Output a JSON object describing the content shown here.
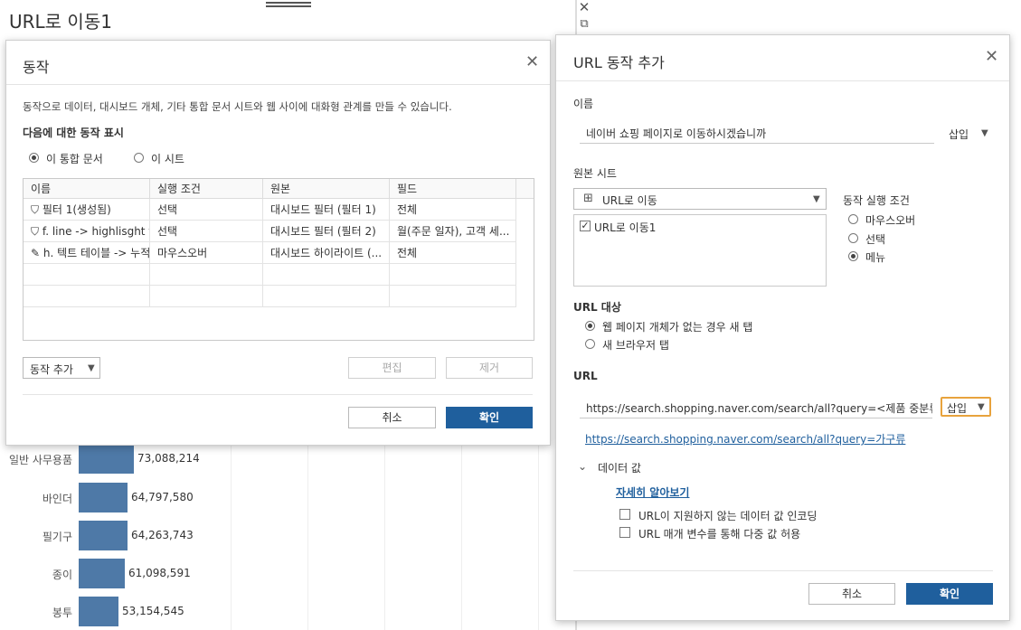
{
  "worksheet": {
    "title": "URL로 이동1",
    "bars": [
      {
        "label": "일반 사무용품",
        "value": 73088214,
        "value_text": "73,088,214"
      },
      {
        "label": "바인더",
        "value": 64797580,
        "value_text": "64,797,580"
      },
      {
        "label": "필기구",
        "value": 64263743,
        "value_text": "64,263,743"
      },
      {
        "label": "종이",
        "value": 61098591,
        "value_text": "61,098,591"
      },
      {
        "label": "봉투",
        "value": 53154545,
        "value_text": "53,154,545"
      }
    ],
    "close_glyph": "✕",
    "popout_glyph": "⧉"
  },
  "actions_dialog": {
    "title": "동작",
    "close_glyph": "✕",
    "description": "동작으로 데이터, 대시보드 개체, 기타 통합 문서 시트와 웹 사이에 대화형 관계를 만들 수 있습니다.",
    "show_for_label": "다음에 대한 동작 표시",
    "scope_options": [
      {
        "label": "이 통합 문서",
        "selected": true
      },
      {
        "label": "이 시트",
        "selected": false
      }
    ],
    "table": {
      "headers": [
        "이름",
        "실행 조건",
        "원본",
        "필드"
      ],
      "rows": [
        {
          "icon": "filter-icon",
          "glyph": "⛉",
          "name": "필터 1(생성됨)",
          "condition": "선택",
          "source": "대시보드 필터 (필터 1)",
          "field": "전체"
        },
        {
          "icon": "filter-icon",
          "glyph": "⛉",
          "name": "f. line -> highlisght ta",
          "condition": "선택",
          "source": "대시보드 필터 (필터 2)",
          "field": "월(주문 일자), 고객 세..."
        },
        {
          "icon": "highlight-icon",
          "glyph": "✎",
          "name": "h. 텍트 테이블 -> 누적",
          "condition": "마우스오버",
          "source": "대시보드 하이라이트 (...",
          "field": "전체"
        }
      ]
    },
    "add_action_label": "동작 추가",
    "edit_label": "편집",
    "remove_label": "제거",
    "cancel_label": "취소",
    "ok_label": "확인"
  },
  "url_dialog": {
    "title": "URL 동작 추가",
    "close_glyph": "✕",
    "name_label": "이름",
    "name_value": "네이버 쇼핑 페이지로 이동하시겠습니까",
    "insert_label": "삽입",
    "source_sheet_label": "원본 시트",
    "source_sheet_value": "URL로 이동",
    "sheet_items": [
      {
        "label": "URL로 이동1",
        "checked": true
      }
    ],
    "run_on_label": "동작 실행 조건",
    "run_on_options": [
      {
        "label": "마우스오버",
        "selected": false
      },
      {
        "label": "선택",
        "selected": false
      },
      {
        "label": "메뉴",
        "selected": true
      }
    ],
    "url_target_label": "URL 대상",
    "url_target_options": [
      {
        "label": "웹 페이지 개체가 없는 경우 새 탭",
        "selected": true
      },
      {
        "label": "새 브라우저 탭",
        "selected": false
      }
    ],
    "url_label": "URL",
    "url_value": "https://search.shopping.naver.com/search/all?query=<제품 중분류",
    "url_insert_label": "삽입",
    "url_preview": "https://search.shopping.naver.com/search/all?query=가구류",
    "data_values_label": "데이터 값",
    "learn_more_label": "자세히 알아보기",
    "options": [
      {
        "label": "URL이 지원하지 않는 데이터 값 인코딩",
        "checked": false
      },
      {
        "label": "URL 매개 변수를 통해 다중 값 허용",
        "checked": false
      }
    ],
    "cancel_label": "취소",
    "ok_label": "확인"
  },
  "colors": {
    "accent": "#1f5f9d",
    "bar": "#4e79a7",
    "focus": "#e8a33d"
  }
}
